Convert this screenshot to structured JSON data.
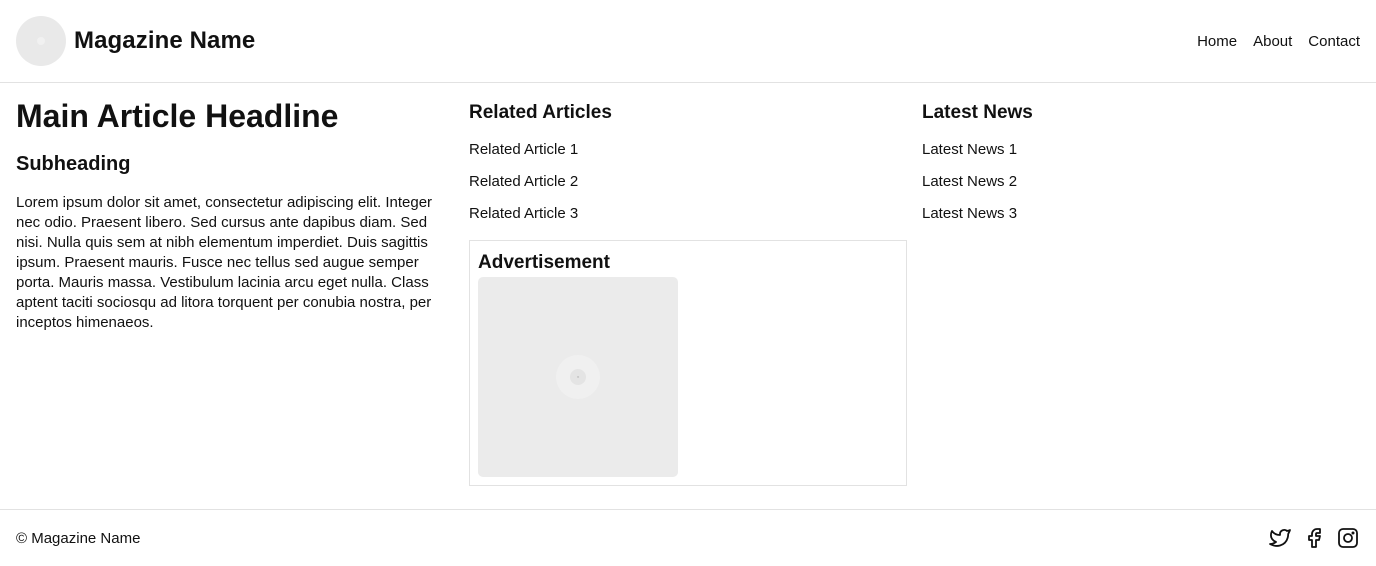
{
  "header": {
    "site_title": "Magazine Name",
    "nav": [
      "Home",
      "About",
      "Contact"
    ]
  },
  "article": {
    "headline": "Main Article Headline",
    "subheading": "Subheading",
    "body": "Lorem ipsum dolor sit amet, consectetur adipiscing elit. Integer nec odio. Praesent libero. Sed cursus ante dapibus diam. Sed nisi. Nulla quis sem at nibh elementum imperdiet. Duis sagittis ipsum. Praesent mauris. Fusce nec tellus sed augue semper porta. Mauris massa. Vestibulum lacinia arcu eget nulla. Class aptent taciti sociosqu ad litora torquent per conubia nostra, per inceptos himenaeos."
  },
  "related": {
    "title": "Related Articles",
    "items": [
      "Related Article 1",
      "Related Article 2",
      "Related Article 3"
    ]
  },
  "advertisement": {
    "title": "Advertisement"
  },
  "latest": {
    "title": "Latest News",
    "items": [
      "Latest News 1",
      "Latest News 2",
      "Latest News 3"
    ]
  },
  "footer": {
    "copyright": "© Magazine Name",
    "social_icons": [
      "twitter-icon",
      "facebook-icon",
      "instagram-icon"
    ]
  }
}
